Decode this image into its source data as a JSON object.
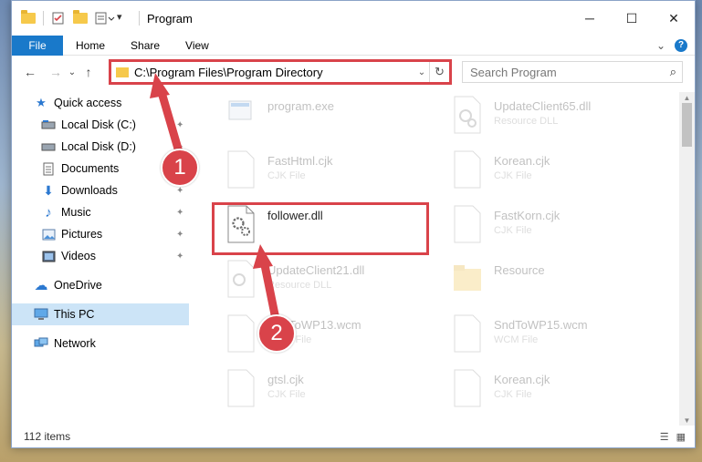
{
  "window": {
    "title": "Program",
    "controls": {
      "minimize": "─",
      "maximize": "☐",
      "close": "✕"
    }
  },
  "ribbon": {
    "tabs": [
      "File",
      "Home",
      "Share",
      "View"
    ],
    "expand_glyph": "⌄",
    "help_glyph": "?"
  },
  "navbar": {
    "back": "←",
    "forward": "→",
    "recent": "⌄",
    "up": "↑",
    "address": "C:\\Program Files\\Program Directory",
    "address_dropdown": "⌄",
    "refresh": "↻",
    "search_placeholder": "Search Program",
    "search_glyph": "⌕"
  },
  "sidebar": {
    "items": [
      {
        "label": "Quick access",
        "icon": "star-icon",
        "glyph": "★",
        "pinned": false
      },
      {
        "label": "Local Disk (C:)",
        "icon": "drive-icon",
        "glyph": "▬",
        "pinned": true
      },
      {
        "label": "Local Disk (D:)",
        "icon": "drive-icon",
        "glyph": "▬",
        "pinned": true
      },
      {
        "label": "Documents",
        "icon": "document-icon",
        "glyph": "▤",
        "pinned": true
      },
      {
        "label": "Downloads",
        "icon": "download-icon",
        "glyph": "⬇",
        "pinned": true
      },
      {
        "label": "Music",
        "icon": "music-icon",
        "glyph": "♪",
        "pinned": true
      },
      {
        "label": "Pictures",
        "icon": "picture-icon",
        "glyph": "▣",
        "pinned": true
      },
      {
        "label": "Videos",
        "icon": "video-icon",
        "glyph": "▦",
        "pinned": true
      },
      {
        "label": "OneDrive",
        "icon": "cloud-icon",
        "glyph": "☁",
        "pinned": false
      },
      {
        "label": "This PC",
        "icon": "computer-icon",
        "glyph": "▭",
        "pinned": false
      },
      {
        "label": "Network",
        "icon": "network-icon",
        "glyph": "⊞",
        "pinned": false
      }
    ],
    "pin_glyph": "📌"
  },
  "files": [
    {
      "name": "program.exe",
      "type": "",
      "icon": "exe-icon"
    },
    {
      "name": "UpdateClient65.dll",
      "type": "Resource DLL",
      "icon": "dll-icon"
    },
    {
      "name": "FastHtml.cjk",
      "type": "CJK File",
      "icon": "file-icon"
    },
    {
      "name": "Korean.cjk",
      "type": "CJK File",
      "icon": "file-icon"
    },
    {
      "name": "follower.dll",
      "type": "",
      "icon": "dll-icon"
    },
    {
      "name": "FastKorn.cjk",
      "type": "CJK File",
      "icon": "file-icon"
    },
    {
      "name": "UpdateClient21.dll",
      "type": "Resource DLL",
      "icon": "dll-icon"
    },
    {
      "name": "Resource",
      "type": "",
      "icon": "folder-icon"
    },
    {
      "name": "SndToWP13.wcm",
      "type": "WCM File",
      "icon": "file-icon"
    },
    {
      "name": "SndToWP15.wcm",
      "type": "WCM File",
      "icon": "file-icon"
    },
    {
      "name": "gtsl.cjk",
      "type": "CJK File",
      "icon": "file-icon"
    },
    {
      "name": "Korean.cjk",
      "type": "CJK File",
      "icon": "file-icon"
    }
  ],
  "status": {
    "item_count": "112 items"
  },
  "callouts": {
    "step1": "1",
    "step2": "2",
    "color": "#d9434a"
  }
}
